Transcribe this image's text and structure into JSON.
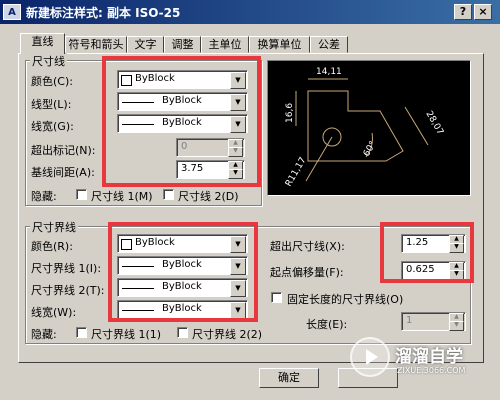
{
  "window": {
    "title": "新建标注样式: 副本 ISO-25",
    "icon_text": "A",
    "help_label": "?",
    "close_label": "×"
  },
  "tabs": [
    "直线",
    "符号和箭头",
    "文字",
    "调整",
    "主单位",
    "换算单位",
    "公差"
  ],
  "active_tab": "直线",
  "dim_lines": {
    "title": "尺寸线",
    "color_label": "颜色(C):",
    "color_value": "ByBlock",
    "linetype_label": "线型(L):",
    "linetype_value": "ByBlock",
    "lineweight_label": "线宽(G):",
    "lineweight_value": "ByBlock",
    "extend_label": "超出标记(N):",
    "extend_value": "0",
    "baseline_label": "基线间距(A):",
    "baseline_value": "3.75",
    "suppress_label": "隐藏:",
    "suppress_1": "尺寸线 1(M)",
    "suppress_2": "尺寸线 2(D)"
  },
  "ext_lines": {
    "title": "尺寸界线",
    "color_label": "颜色(R):",
    "color_value": "ByBlock",
    "linetype1_label": "尺寸界线 1(I):",
    "linetype1_value": "ByBlock",
    "linetype2_label": "尺寸界线 2(T):",
    "linetype2_value": "ByBlock",
    "lineweight_label": "线宽(W):",
    "lineweight_value": "ByBlock",
    "suppress_label": "隐藏:",
    "suppress_1": "尺寸界线 1(1)",
    "suppress_2": "尺寸界线 2(2)",
    "beyond_label": "超出尺寸线(X):",
    "beyond_value": "1.25",
    "offset_label": "起点偏移量(F):",
    "offset_value": "0.625",
    "fixed_label": "固定长度的尺寸界线(O)",
    "length_label": "长度(E):",
    "length_value": "1"
  },
  "preview": {
    "dim_top": "14,11",
    "dim_left": "16,6",
    "dim_right": "28,07",
    "dim_angle": "60°",
    "dim_radius": "R11,17"
  },
  "buttons": {
    "ok": "确定"
  },
  "watermark": {
    "text": "溜溜自学",
    "url": "ZIXUE.3066.COM"
  },
  "colors": {
    "highlight": "#e8383d",
    "preview_stroke": "#c8a878",
    "titlebar": "#0a246a"
  }
}
